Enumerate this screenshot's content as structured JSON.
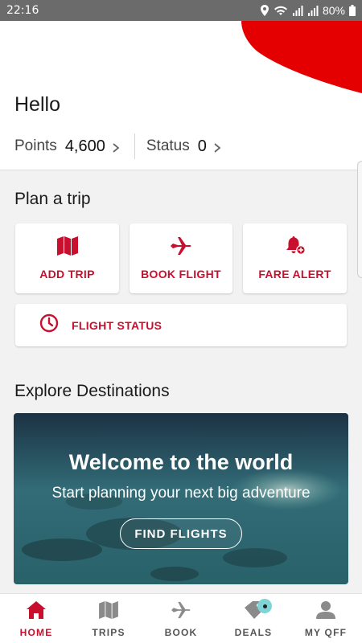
{
  "status_bar": {
    "time": "22:16",
    "battery": "80%",
    "icons": [
      "location-icon",
      "wifi-icon",
      "signal-icon",
      "signal-icon",
      "battery-icon"
    ]
  },
  "greeting": "Hello",
  "stats": {
    "points_label": "Points",
    "points_value": "4,600",
    "status_label": "Status",
    "status_value": "0"
  },
  "plan": {
    "title": "Plan a trip",
    "tiles": [
      {
        "label": "ADD TRIP",
        "icon": "map-icon"
      },
      {
        "label": "BOOK FLIGHT",
        "icon": "plane-icon"
      },
      {
        "label": "FARE ALERT",
        "icon": "bell-plus-icon"
      }
    ],
    "flight_status": {
      "label": "FLIGHT STATUS",
      "icon": "clock-icon"
    }
  },
  "explore": {
    "title": "Explore Destinations",
    "card_title": "Welcome to the world",
    "card_subtitle": "Start planning your next big adventure",
    "button_label": "FIND FLIGHTS"
  },
  "nav": {
    "items": [
      {
        "label": "HOME",
        "icon": "home-icon",
        "active": true
      },
      {
        "label": "TRIPS",
        "icon": "map-icon",
        "active": false
      },
      {
        "label": "BOOK",
        "icon": "plane-icon",
        "active": false
      },
      {
        "label": "DEALS",
        "icon": "tag-icon",
        "active": false
      },
      {
        "label": "MY QFF",
        "icon": "person-icon",
        "active": false
      }
    ]
  },
  "colors": {
    "brand_red": "#c8102e",
    "status_bar": "#6b6b6b",
    "deal_badge": "#7fd4d8"
  }
}
